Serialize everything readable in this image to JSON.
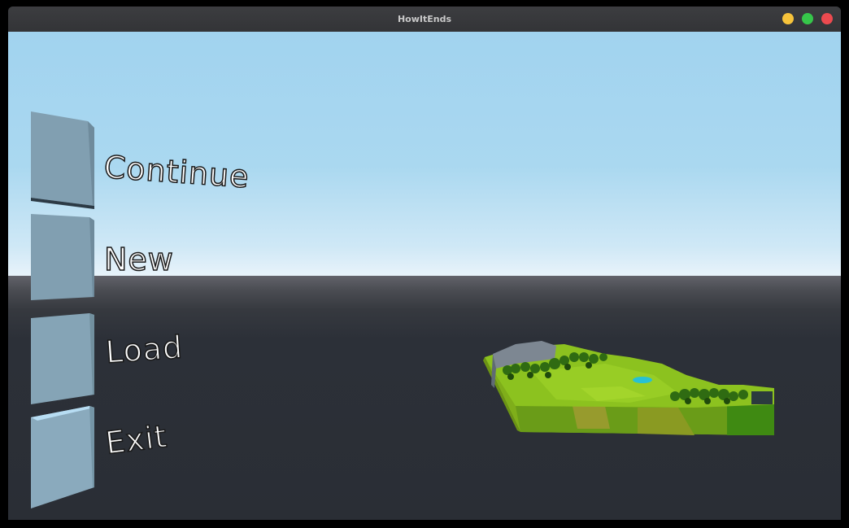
{
  "window": {
    "title": "HowItEnds",
    "controls": [
      "minimize",
      "maximize",
      "close"
    ],
    "colors": {
      "minimize": "#f6c33b",
      "maximize": "#36c64a",
      "close": "#ec4a4f"
    }
  },
  "scene": {
    "sky_color": "#a1d3ef",
    "ground_color": "#2a2e35",
    "terrain_preview": "voxel-island-with-trees-and-pond"
  },
  "menu": {
    "items": [
      {
        "id": "continue",
        "label": "Continue"
      },
      {
        "id": "new",
        "label": "New"
      },
      {
        "id": "load",
        "label": "Load"
      },
      {
        "id": "exit",
        "label": "Exit"
      }
    ],
    "block_color": "#819fb1"
  }
}
